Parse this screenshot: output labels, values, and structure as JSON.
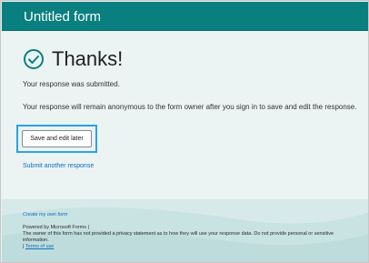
{
  "header": {
    "title": "Untitled form",
    "color": "#0a7f7f"
  },
  "confirmation": {
    "icon": "check-circle-icon",
    "title": "Thanks!",
    "submitted_text": "Your response was submitted.",
    "anonymous_text": "Your response will remain anonymous to the form owner after you sign in to save and edit the response.",
    "save_button_label": "Save and edit later",
    "submit_another_link": "Submit another response"
  },
  "footer": {
    "create_link": "Create my own form",
    "powered_by": "Powered by Microsoft Forms |",
    "privacy_line_1": "The owner of this form has not provided a privacy statement as to how they will use your response data. Do not provide personal or sensitive",
    "privacy_line_2": "information.",
    "terms_separator": "|",
    "terms_link": "Terms of use"
  },
  "colors": {
    "accent": "#0a7f7f",
    "link": "#0a6fbf",
    "focus_outline": "#2aa3e8"
  }
}
